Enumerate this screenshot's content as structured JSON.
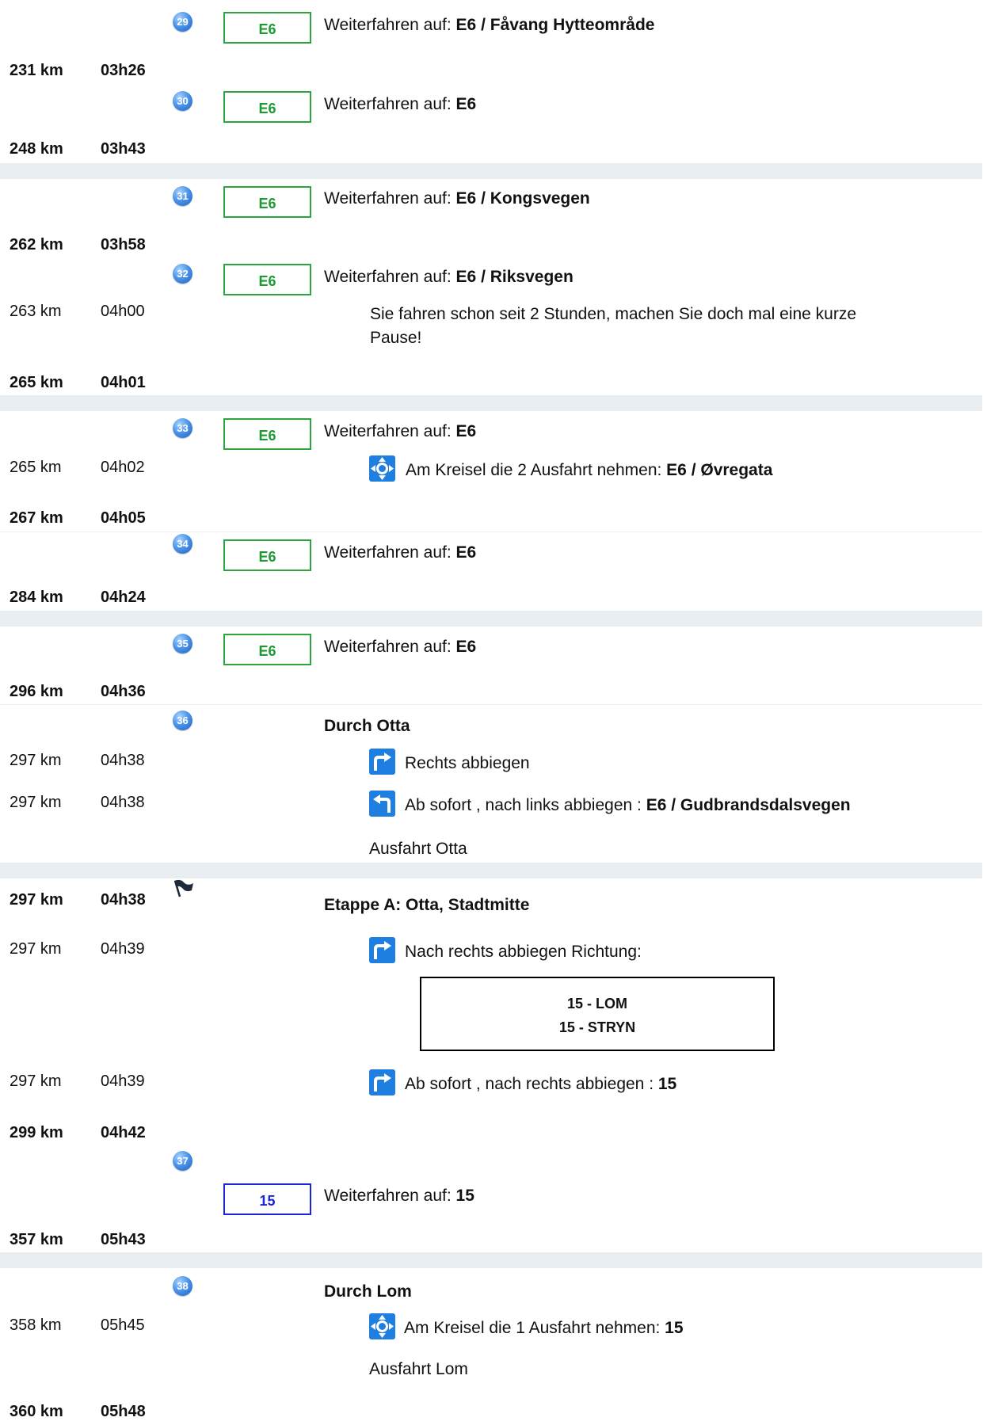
{
  "continue_label": "Weiterfahren auf: ",
  "steps": [
    {
      "num": "29",
      "road": "E6",
      "dest": "E6 / Fåvang Hytteområde"
    },
    {
      "num": "30",
      "road": "E6",
      "dest": "E6"
    },
    {
      "num": "31",
      "road": "E6",
      "dest": "E6 / Kongsvegen"
    },
    {
      "num": "32",
      "road": "E6",
      "dest": "E6 / Riksvegen"
    },
    {
      "num": "33",
      "road": "E6",
      "dest": "E6"
    },
    {
      "num": "34",
      "road": "E6",
      "dest": "E6"
    },
    {
      "num": "35",
      "road": "E6",
      "dest": "E6"
    },
    {
      "num": "36",
      "title": "Durch Otta"
    },
    {
      "num": "",
      "title": "Etappe A: Otta, Stadtmitte"
    },
    {
      "num": "37",
      "road": "15",
      "dest": "15"
    },
    {
      "num": "38",
      "title": "Durch Lom"
    }
  ],
  "summaries": [
    {
      "dist": "231 km",
      "time": "03h26"
    },
    {
      "dist": "248 km",
      "time": "03h43"
    },
    {
      "dist": "262 km",
      "time": "03h58"
    },
    {
      "dist": "265 km",
      "time": "04h01"
    },
    {
      "dist": "267 km",
      "time": "04h05"
    },
    {
      "dist": "284 km",
      "time": "04h24"
    },
    {
      "dist": "296 km",
      "time": "04h36"
    },
    {
      "dist": "297 km",
      "time": "04h38"
    },
    {
      "dist": "299 km",
      "time": "04h42"
    },
    {
      "dist": "357 km",
      "time": "05h43"
    },
    {
      "dist": "360 km",
      "time": "05h48"
    }
  ],
  "details": [
    {
      "dist": "263 km",
      "time": "04h00",
      "text": "Sie fahren schon seit 2 Stunden, machen Sie doch mal eine kurze",
      "text2": "Pause!"
    },
    {
      "dist": "265 km",
      "time": "04h02",
      "text": "Am Kreisel die 2 Ausfahrt nehmen: ",
      "bold": "E6 / Øvregata"
    },
    {
      "dist": "297 km",
      "time": "04h38",
      "text": "Rechts abbiegen"
    },
    {
      "dist": "297 km",
      "time": "04h38",
      "text": "Ab sofort , nach links abbiegen : ",
      "bold": "E6 / Gudbrandsdalsvegen"
    },
    {
      "dist": "297 km",
      "time": "04h39",
      "text": "Nach rechts abbiegen Richtung:"
    },
    {
      "dist": "297 km",
      "time": "04h39",
      "text": "Ab sofort , nach rechts abbiegen : ",
      "bold": "15"
    },
    {
      "dist": "358 km",
      "time": "05h45",
      "text": "Am Kreisel die 1 Ausfahrt nehmen: ",
      "bold": "15"
    }
  ],
  "exits": [
    "Ausfahrt Otta",
    "Ausfahrt Lom"
  ],
  "sign": [
    "15 - LOM",
    "15 - STRYN"
  ]
}
